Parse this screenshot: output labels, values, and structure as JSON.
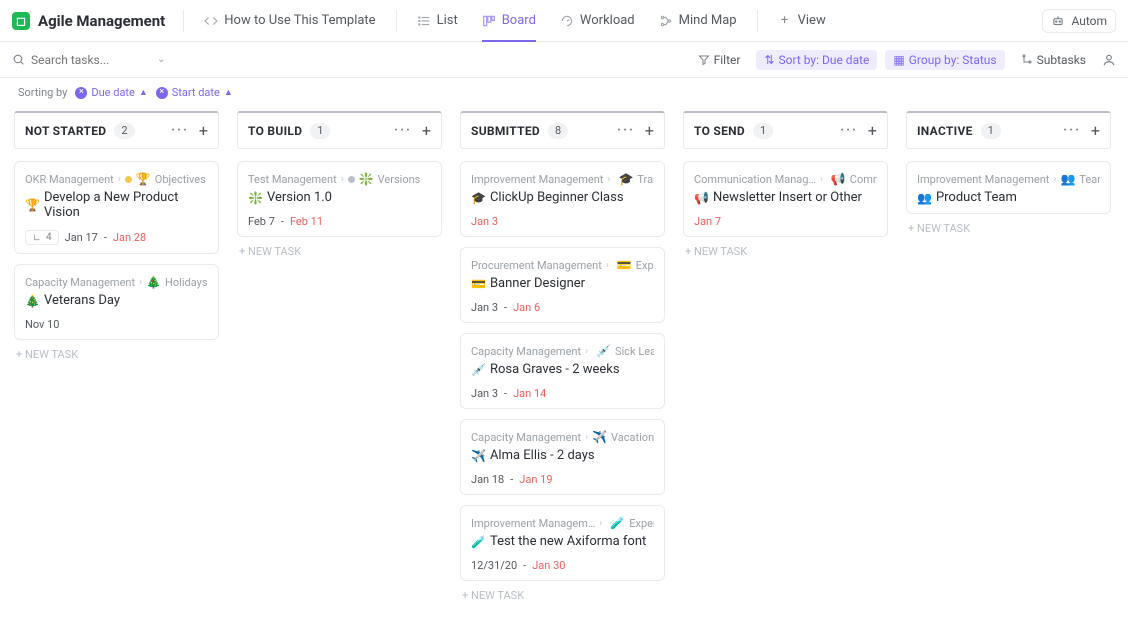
{
  "header": {
    "app_name": "Agile Management",
    "tabs": [
      {
        "label": "How to Use This Template",
        "icon": "code-icon"
      },
      {
        "label": "List",
        "icon": "list-icon"
      },
      {
        "label": "Board",
        "icon": "board-icon",
        "active": true
      },
      {
        "label": "Workload",
        "icon": "workload-icon"
      },
      {
        "label": "Mind Map",
        "icon": "mindmap-icon"
      }
    ],
    "add_view": "View",
    "automations": "Autom"
  },
  "toolbar": {
    "search_placeholder": "Search tasks...",
    "filter": "Filter",
    "sort": "Sort by: Due date",
    "group": "Group by: Status",
    "subtasks": "Subtasks"
  },
  "sorting": {
    "label": "Sorting by",
    "pills": [
      {
        "label": "Due date"
      },
      {
        "label": "Start date"
      }
    ]
  },
  "columns": [
    {
      "title": "NOT STARTED",
      "count": "2",
      "cards": [
        {
          "path": "OKR Management",
          "sub": "Objectives",
          "sub_emoji": "🏆",
          "dot": "#f2c94c",
          "title": "Develop a New Product Vision",
          "emoji": "🏆",
          "subtasks": "4",
          "d1": "Jan 17",
          "d2": "Jan 28"
        },
        {
          "path": "Capacity Management",
          "sub": "Holidays",
          "sub_emoji": "🎄",
          "dot": "",
          "title": "Veterans Day",
          "emoji": "🎄",
          "d1": "Nov 10"
        }
      ]
    },
    {
      "title": "TO BUILD",
      "count": "1",
      "cards": [
        {
          "path": "Test Management",
          "sub": "Versions",
          "sub_emoji": "❇️",
          "dot": "#b9bec7",
          "title": "Version 1.0",
          "emoji": "❇️",
          "d1": "Feb 7",
          "d2": "Feb 11"
        }
      ]
    },
    {
      "title": "SUBMITTED",
      "count": "8",
      "cards": [
        {
          "path": "Improvement Management",
          "sub": "Trainings",
          "sub_emoji": "🎓",
          "dot": "#2a2e34",
          "title": "ClickUp Beginner Class",
          "emoji": "🎓",
          "d2": "Jan 3"
        },
        {
          "path": "Procurement Management",
          "sub": "Expenses",
          "sub_emoji": "💳",
          "dot": "#f2994a",
          "title": "Banner Designer",
          "emoji": "💳",
          "d1": "Jan 3",
          "d2": "Jan 6"
        },
        {
          "path": "Capacity Management",
          "sub": "Sick Leave",
          "sub_emoji": "💉",
          "dot": "#ee5e5e",
          "title": "Rosa Graves - 2 weeks",
          "emoji": "💉",
          "d1": "Jan 3",
          "d2": "Jan 14"
        },
        {
          "path": "Capacity Management",
          "sub": "Vacations",
          "sub_emoji": "✈️",
          "dot": "",
          "title": "Alma Ellis - 2 days",
          "emoji": "✈️",
          "d1": "Jan 18",
          "d2": "Jan 19"
        },
        {
          "path": "Improvement Managem…",
          "sub": "Experime…",
          "sub_emoji": "🧪",
          "dot": "#27ae60",
          "title": "Test the new Axiforma font",
          "emoji": "🧪",
          "d1": "12/31/20",
          "d2": "Jan 30"
        }
      ]
    },
    {
      "title": "TO SEND",
      "count": "1",
      "cards": [
        {
          "path": "Communication Manag…",
          "sub": "Communica…",
          "sub_emoji": "📢",
          "dot": "#b9bec7",
          "title": "Newsletter Insert or Other",
          "emoji": "📢",
          "d2": "Jan 7"
        }
      ]
    },
    {
      "title": "INACTIVE",
      "count": "1",
      "cards": [
        {
          "path": "Improvement Management",
          "sub": "Team Status",
          "sub_emoji": "👥",
          "dot": "",
          "title": "Product Team",
          "emoji": "👥"
        }
      ]
    }
  ],
  "new_task": "+ NEW TASK"
}
